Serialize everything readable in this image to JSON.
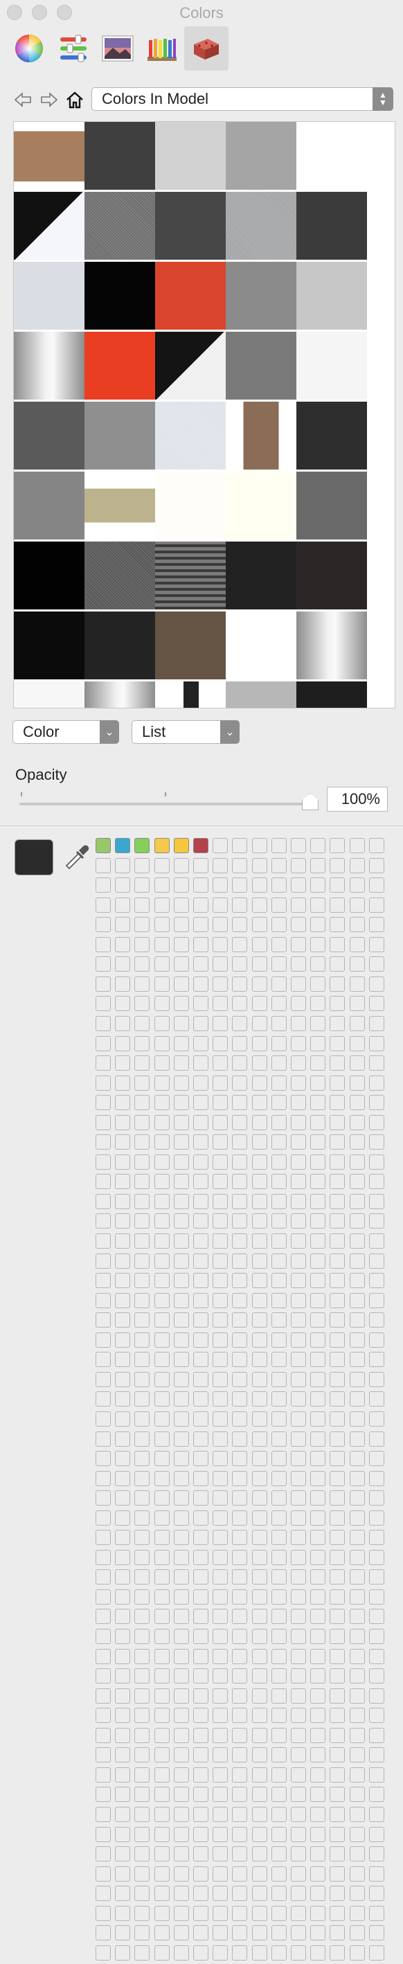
{
  "window": {
    "title": "Colors"
  },
  "toolbar": {
    "tools": [
      {
        "name": "color-wheel-icon"
      },
      {
        "name": "color-sliders-icon"
      },
      {
        "name": "image-palettes-icon"
      },
      {
        "name": "pencils-icon"
      },
      {
        "name": "brick-materials-icon",
        "active": true
      }
    ]
  },
  "navigation": {
    "back": "back-arrow-icon",
    "forward": "forward-arrow-icon",
    "home": "home-icon",
    "collection": "Colors In Model"
  },
  "materials": [
    {
      "c": "#a77e5e",
      "kind": "tex"
    },
    {
      "c": "#3f3f3f"
    },
    {
      "c": "#d2d2d2"
    },
    {
      "c": "#a5a5a5"
    },
    {
      "c": "#ffffff"
    },
    {
      "c": "#111111",
      "kind": "diag-dark"
    },
    {
      "c": "#6e6e6e",
      "kind": "noise"
    },
    {
      "c": "#474747"
    },
    {
      "c": "#a3a5a7",
      "kind": "noise"
    },
    {
      "c": "#3b3b3b"
    },
    {
      "c": "#d8dce2",
      "kind": "noise"
    },
    {
      "c": "#050505"
    },
    {
      "c": "#d9452e"
    },
    {
      "c": "#8b8b8b"
    },
    {
      "c": "#c7c7c7"
    },
    {
      "c": "#d6d6d6",
      "kind": "metal"
    },
    {
      "c": "#ea3e23"
    },
    {
      "c": "#141414",
      "kind": "diag-light"
    },
    {
      "c": "#7a7a7a"
    },
    {
      "c": "#f5f5f5"
    },
    {
      "c": "#5a5a5a"
    },
    {
      "c": "#8f8f8f"
    },
    {
      "c": "#dfe4ea",
      "kind": "noise"
    },
    {
      "c": "#8b6c56",
      "kind": "bark"
    },
    {
      "c": "#2e2e2e"
    },
    {
      "c": "#858585"
    },
    {
      "c": "#bcb28d",
      "kind": "band"
    },
    {
      "c": "#fffdf9"
    },
    {
      "c": "#fffff2"
    },
    {
      "c": "#696969"
    },
    {
      "c": "#020202"
    },
    {
      "c": "#575757",
      "kind": "noise"
    },
    {
      "c": "#5e5e5e",
      "kind": "stripe"
    },
    {
      "c": "#222222"
    },
    {
      "c": "#2b2727"
    },
    {
      "c": "#0b0b0b"
    },
    {
      "c": "#232323"
    },
    {
      "c": "#655443"
    },
    {
      "c": "#ffffff"
    },
    {
      "c": "#c8c8c8",
      "kind": "metal"
    },
    {
      "c": "#f7f7f7"
    },
    {
      "c": "#a0a0a0",
      "kind": "metal"
    },
    {
      "c": "#ffffff",
      "kind": "figure"
    },
    {
      "c": "#b7b7b7"
    },
    {
      "c": "#1e1e1e"
    }
  ],
  "controls": {
    "color_select": "Color",
    "view_select": "List"
  },
  "opacity": {
    "label": "Opacity",
    "value": "100%",
    "slider_level": 1.0
  },
  "current_color": "#2b2b2b",
  "eyedropper": "eyedropper-icon",
  "swatches": {
    "columns": 15,
    "rows": 57,
    "filled": [
      "#98c86a",
      "#3aa7d0",
      "#86cf5b",
      "#f5c94a",
      "#f6c73d",
      "#b4424c"
    ]
  }
}
